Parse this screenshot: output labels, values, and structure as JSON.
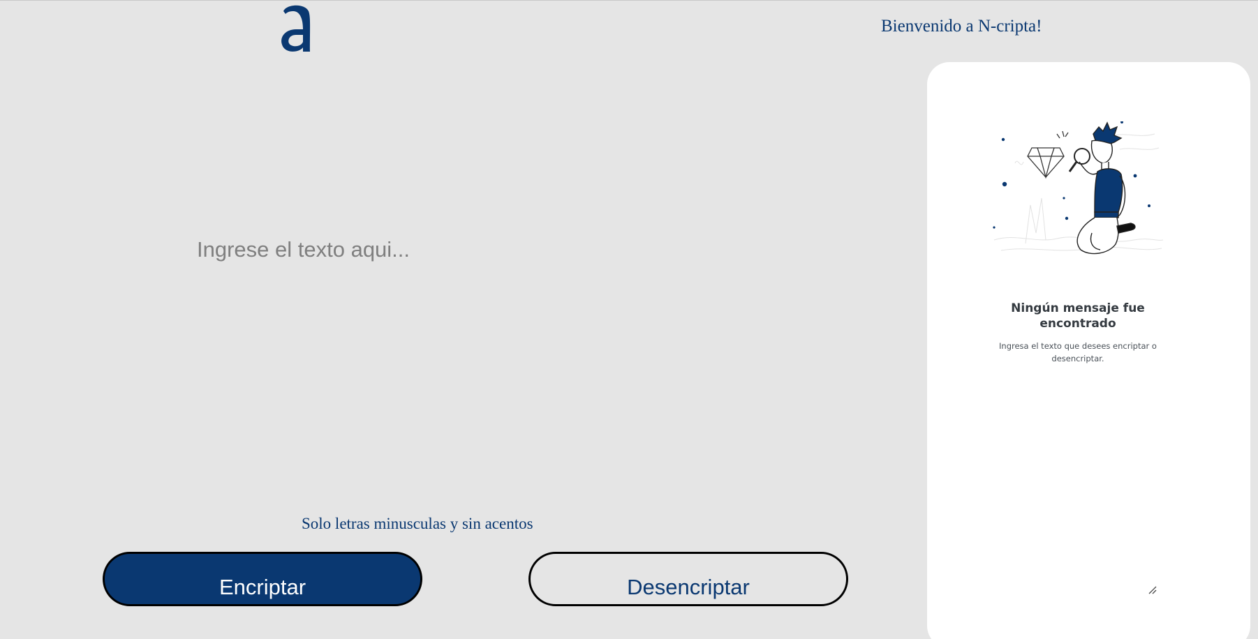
{
  "header": {
    "logo_letter": "a",
    "welcome": "Bienvenido a N-cripta!"
  },
  "input": {
    "placeholder": "Ingrese el texto aqui...",
    "value": ""
  },
  "hint": "Solo letras minusculas y sin acentos",
  "buttons": {
    "encrypt_label": "Encriptar",
    "decrypt_label": "Desencriptar"
  },
  "output": {
    "title_line1": "Ningún mensaje fue",
    "title_line2": "encontrado",
    "subtitle_line1": "Ingresa el texto que desees encriptar o",
    "subtitle_line2": "desencriptar.",
    "illustration": "person-with-magnifying-glass-illustration"
  },
  "colors": {
    "background": "#e5e5e5",
    "primary": "#0a3871",
    "panel": "#ffffff"
  }
}
